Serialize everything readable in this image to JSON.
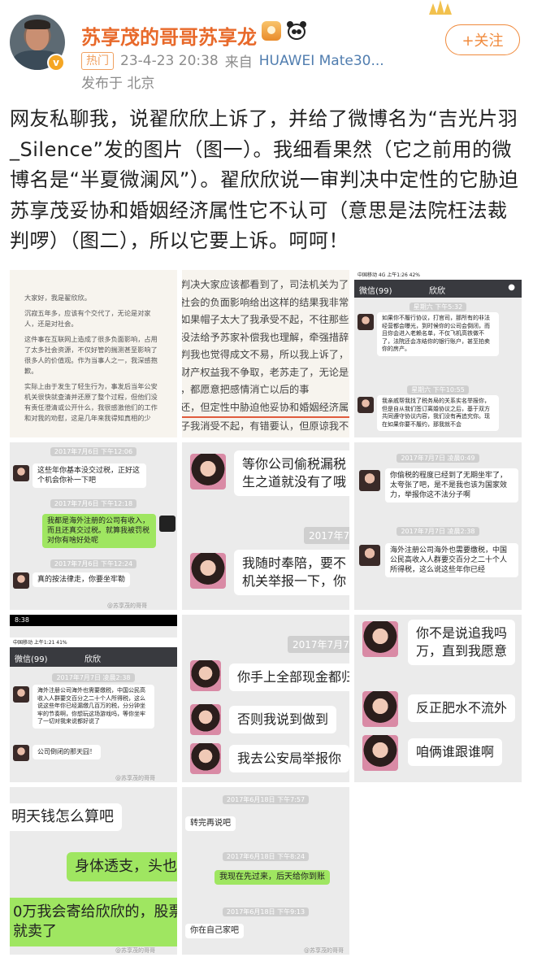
{
  "header": {
    "username": "苏享茂的哥哥苏享龙",
    "hot_tag": "热门",
    "datetime": "23-4-23 20:38",
    "source_prefix": "来自",
    "source_device": "HUAWEI Mate30...",
    "location": "发布于 北京",
    "follow_label": "+关注",
    "verified_badge": "v"
  },
  "post": {
    "text": "网友私聊我，说翟欣欣上诉了，并给了微博名为“吉光片羽_Silence”发的图片（图一）。我细看果然（它之前用的微博名是“半夏微澜风”）。翟欣欣说一审判决中定性的它胁迫苏享茂妥协和婚姻经济属性它不认可（意思是法院枉法裁判啰）（图二），所以它要上诉。呵呵！"
  },
  "images": {
    "img1": {
      "lines": [
        "大家好，我是翟欣欣。",
        "沉寂五年多，应该有个交代了，无论是对家",
        "人，还是对社会。",
        "这件事在互联网上造成了很多负面影响，占用",
        "了太多社会资源，不仅好管的揣测甚至影响了",
        "很多人的价值观。作为当事人之一，我深感抱",
        "歉。",
        "实际上由于发生了轻生行为，事发后当年公安",
        "机关很快就查清并还原了整个过程，但他们没",
        "有责任澄清或公开什么，我很感激他们的工作",
        "和对我的劝慰，这是几年来我得知真相的少"
      ]
    },
    "img2": {
      "lines": [
        "判决大家应该都看到了，司法机关为了",
        "社会的负面影响给出这样的结果我非常",
        "如果帽子太大了我承受不起，不往那些莫须",
        "没法给予苏家补偿我也理解，牵强措辞",
        "判我也觉得成文不易，所以我上诉了，",
        "财产权益我不争取，老苏走了，无论是",
        "，都愿意把感情消亡以后的事",
        "还，但定性中胁迫他妥协和婚姻经济属",
        "子我消受不起，有错要认，但原谅我不"
      ]
    },
    "img3": {
      "status": "中国移动 4G 上午1:26 42%",
      "back": "微信(99)",
      "title": "欣欣",
      "ts1": "星期六 下午5:32",
      "msg1": "如果你不履行协议，打官司，那所有的非法经营都会曝光，到时候你的公司会倒闭，而且你会进入老赖名单，不仅飞机高铁做不了，法院还会冻结你的银行账户，甚至拍卖你的房产。",
      "ts2": "星期六 下午10:55",
      "msg2": "我亲戚帮我找了税务局的关系实名举报你，但是自从我们签订离婚协议之后，基于双方共同遵守协议内容，我们没有再追究你。现在如果你要不履约，那我就不会"
    },
    "img4": {
      "ts1": "2017年7月6日 下午12:06",
      "msg1": "这些年你基本没交过税，正好这个机会你补一下吧",
      "ts2": "2017年7月6日 下午12:18",
      "msg2": "我都是海外注册的公司有收入，而且还真交过税。就算我被罚税对你有啥好处呢",
      "ts3": "2017年7月6日 下午12:24",
      "msg3": "真的按法律走，你要坐牢勒"
    },
    "img5": {
      "msg1": "等你公司偷税漏税",
      "msg1b": "生之道就没有了哦",
      "ts": "2017年7月",
      "msg2": "我随时奉陪，要不",
      "msg2b": "机关举报一下，你"
    },
    "img6": {
      "ts1": "2017年7月7日 凌晨0:49",
      "msg1": "你偷税的程度已经到了无期坐牢了，太夸张了吧，是不是我也该为国家效力，举报你这不法分子啊",
      "ts2": "2017年7月7日 凌晨2:38",
      "msg2": "海外注册公司海外也需要缴税，中国公民高收入人群要交百分之二十个人所得税，这么说这些年你已经"
    },
    "img7": {
      "time": "8:38",
      "status": "中国移动 上午1:21 41%",
      "back": "微信(99)",
      "title": "欣欣",
      "ts": "2017年7月7日 凌晨2:38",
      "msg1": "海外注册公司海外也需要缴税，中国公民高收入人群要交百分之二十个人所得税，这么说这些年你已经漏缴几百万的税，分分钟坐牢的节奏啊，你想玩这场游戏吗，等你坐牢了一切对我来说都好说了",
      "msg2": "公司倒闭的那天囧！"
    },
    "img8": {
      "ts": "2017年7月7日",
      "msg1": "你手上全部现金都归",
      "msg2": "否则我说到做到",
      "msg3": "我去公安局举报你"
    },
    "img9": {
      "msg1": "你不是说追我吗",
      "msg1b": "万，直到我愿意",
      "msg2": "反正肥水不流外",
      "msg3": "咱俩谁跟谁啊"
    },
    "img10": {
      "msg1": "明天钱怎么算吧",
      "msg2": "身体透支，头也好",
      "msg3": "0万我会寄给欣欣的，股票今",
      "msg3b": "就卖了"
    },
    "img11": {
      "ts1": "2017年6月18日 下午7:57",
      "msg1": "转完再说吧",
      "ts2": "2017年6月18日 下午8:24",
      "msg2": "我现在先过来，后天给你到账",
      "ts3": "2017年6月18日 下午9:13",
      "msg3": "你在自己家吧"
    },
    "watermark": "@苏享茂的哥哥"
  },
  "icons": {
    "medal": "medal-icon",
    "panda": "panda-icon",
    "crown": "crown-decoration-icon"
  },
  "colors": {
    "username": "#e8692a",
    "follow": "#f08a3c",
    "link": "#507daf",
    "wechat_green": "#9fe661"
  }
}
